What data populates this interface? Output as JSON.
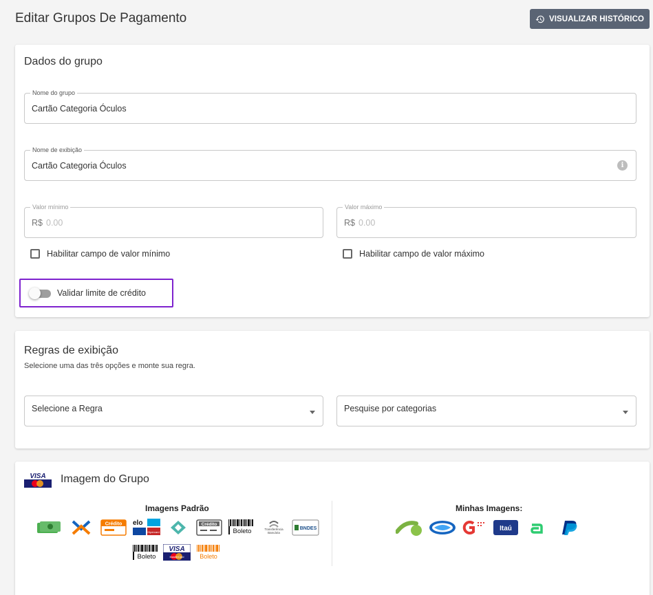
{
  "header": {
    "title": "Editar Grupos De Pagamento",
    "history_button": "VISUALIZAR HISTÓRICO"
  },
  "group_data": {
    "title": "Dados do grupo",
    "group_name": {
      "label": "Nome do grupo",
      "value": "Cartão Categoria Óculos"
    },
    "display_name": {
      "label": "Nome de exibição",
      "value": "Cartão Categoria Óculos"
    },
    "min_value": {
      "label": "Valor mínimo",
      "prefix": "R$",
      "placeholder": "0.00"
    },
    "max_value": {
      "label": "Valor máximo",
      "prefix": "R$",
      "placeholder": "0.00"
    },
    "enable_min": {
      "label": "Habilitar campo de valor mínimo",
      "checked": false
    },
    "enable_max": {
      "label": "Habilitar campo de valor máximo",
      "checked": false
    },
    "credit_limit": {
      "label": "Validar limite de crédito",
      "enabled": false
    }
  },
  "display_rules": {
    "title": "Regras de exibição",
    "subtitle": "Selecione uma das três opções e monte sua regra.",
    "rule_select": "Selecione a Regra",
    "category_search": "Pesquise por categorias"
  },
  "group_image": {
    "title": "Imagem do Grupo",
    "default_heading": "Imagens Padrão",
    "mine_heading": "Minhas Imagens:",
    "default_images": [
      "money-icon",
      "pix-icon",
      "credito-icon",
      "elo-hipercard-icon",
      "diamond-icon",
      "credito-card-icon",
      "boleto-icon",
      "transferencia-bancaria-icon",
      "bndes-icon",
      "boleto-barcode-icon",
      "visa-mastercard-icon",
      "boleto-orange-icon"
    ],
    "default_texts": {
      "credito": "Crédito",
      "elo": "elo",
      "hipercard": "Hipercard",
      "credito_card": "Crédito",
      "boleto": "Boleto",
      "transferencia": "Transferência Bancária",
      "bndes": "BNDES",
      "boleto2": "Boleto",
      "visa": "VISA",
      "mastercard": "MasterCard",
      "boleto_orange": "Boleto"
    },
    "my_images": [
      "green-brand-icon",
      "bank-handshake-icon",
      "getnet-icon",
      "itau-icon",
      "green-a-icon",
      "paypal-icon"
    ],
    "my_texts": {
      "itau": "Itaú"
    },
    "colors": {
      "accent": "#7e22ce",
      "button": "#5a6474"
    }
  }
}
